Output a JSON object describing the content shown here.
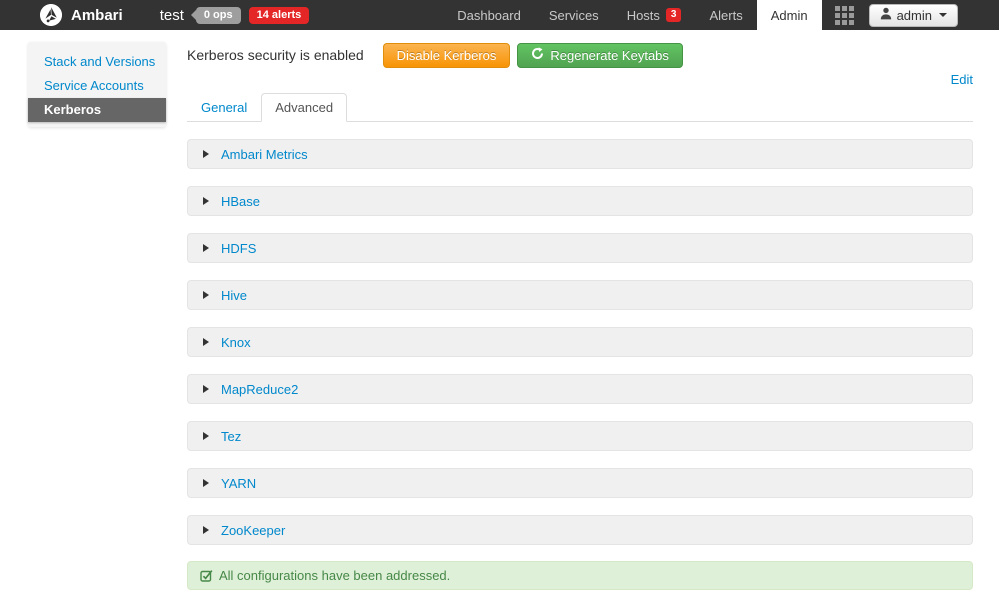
{
  "topbar": {
    "brand": "Ambari",
    "cluster_name": "test",
    "ops_badge": "0 ops",
    "alerts_badge": "14 alerts",
    "nav": [
      {
        "label": "Dashboard"
      },
      {
        "label": "Services"
      },
      {
        "label": "Hosts",
        "badge": "3"
      },
      {
        "label": "Alerts"
      },
      {
        "label": "Admin"
      }
    ],
    "user_label": "admin"
  },
  "sidebar": {
    "items": [
      {
        "label": "Stack and Versions"
      },
      {
        "label": "Service Accounts"
      },
      {
        "label": "Kerberos"
      }
    ]
  },
  "main": {
    "status_text": "Kerberos security is enabled",
    "disable_button": "Disable Kerberos",
    "regenerate_button": "Regenerate Keytabs",
    "edit_link": "Edit",
    "tabs": [
      {
        "label": "General"
      },
      {
        "label": "Advanced"
      }
    ],
    "services": [
      "Ambari Metrics",
      "HBase",
      "HDFS",
      "Hive",
      "Knox",
      "MapReduce2",
      "Tez",
      "YARN",
      "ZooKeeper"
    ],
    "success_message": "All configurations have been addressed."
  },
  "colors": {
    "topbar_bg": "#333333",
    "link_blue": "#0088cc",
    "warning_orange": "#f89406",
    "success_green": "#51a351",
    "alert_red": "#e42626",
    "active_sidebar_bg": "#666666",
    "success_bg": "#dff0d8",
    "success_text": "#468847",
    "panel_bg": "#f0f0f0"
  }
}
